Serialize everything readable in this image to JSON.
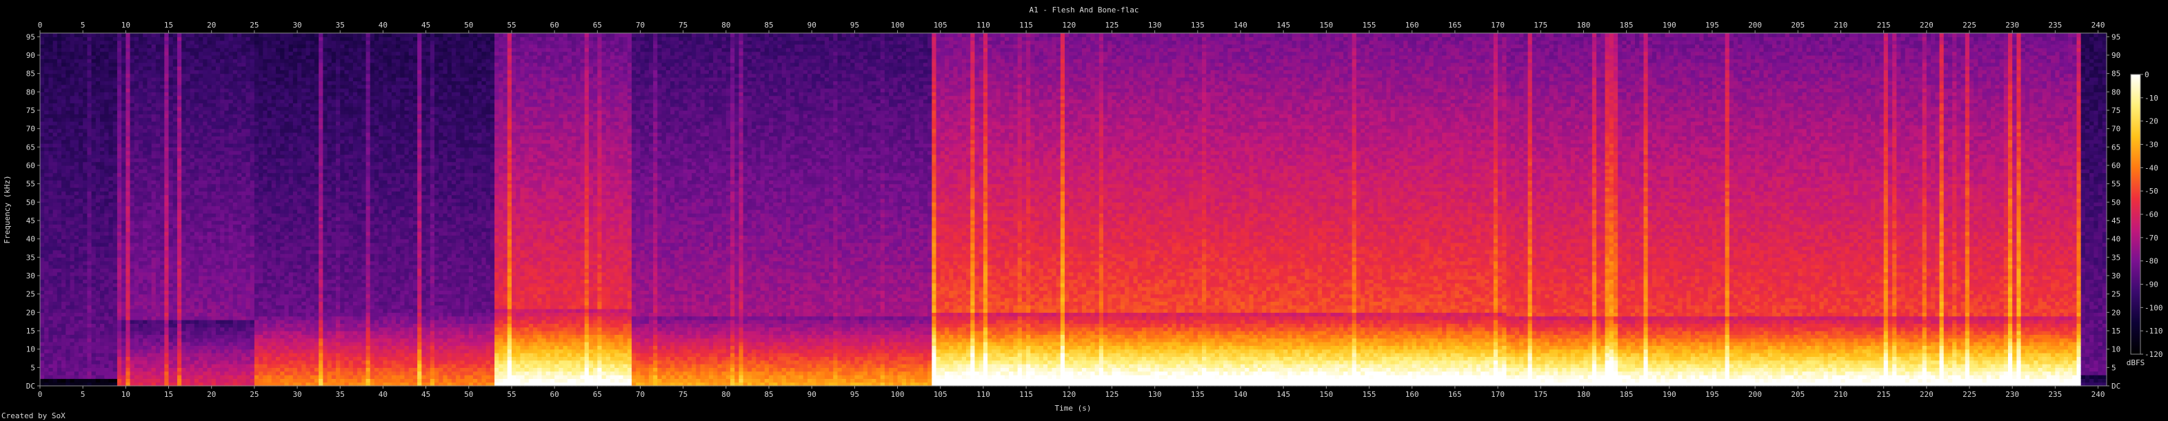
{
  "chart_data": {
    "type": "heatmap",
    "title": "A1 - Flesh And Bone-flac",
    "xlabel": "Time (s)",
    "ylabel": "Frequency (kHz)",
    "xlim": [
      0,
      241
    ],
    "ylim": [
      0,
      96
    ],
    "x_ticks": [
      0,
      5,
      10,
      15,
      20,
      25,
      30,
      35,
      40,
      45,
      50,
      55,
      60,
      65,
      70,
      75,
      80,
      85,
      90,
      95,
      100,
      105,
      110,
      115,
      120,
      125,
      130,
      135,
      140,
      145,
      150,
      155,
      160,
      165,
      170,
      175,
      180,
      185,
      190,
      195,
      200,
      205,
      210,
      215,
      220,
      225,
      230,
      235,
      240
    ],
    "y_ticks": [
      0,
      5,
      10,
      15,
      20,
      25,
      30,
      35,
      40,
      45,
      50,
      55,
      60,
      65,
      70,
      75,
      80,
      85,
      90,
      95
    ],
    "y_zero_label": "DC",
    "colorbar": {
      "label": "dBFS",
      "ticks": [
        0,
        -10,
        -20,
        -30,
        -40,
        -50,
        -60,
        -70,
        -80,
        -90,
        -100,
        -110,
        -120
      ],
      "colors": [
        "#000000",
        "#0d0235",
        "#3a0a6e",
        "#7a1190",
        "#c2187a",
        "#ee2f3c",
        "#ff7a12",
        "#ffc21a",
        "#fff07a",
        "#ffffff"
      ]
    },
    "segments": [
      {
        "start": 0,
        "end": 9,
        "intensity": 0.05,
        "band_khz": 2,
        "hf": 0.3
      },
      {
        "start": 9,
        "end": 25,
        "intensity": 0.45,
        "band_khz": 18,
        "hf": 0.35
      },
      {
        "start": 25,
        "end": 53,
        "intensity": 0.6,
        "band_khz": 20,
        "hf": 0.3
      },
      {
        "start": 53,
        "end": 69,
        "intensity": 0.9,
        "band_khz": 21,
        "hf": 0.55
      },
      {
        "start": 69,
        "end": 104,
        "intensity": 0.65,
        "band_khz": 19,
        "hf": 0.4
      },
      {
        "start": 104,
        "end": 171,
        "intensity": 0.95,
        "band_khz": 20,
        "hf": 0.6
      },
      {
        "start": 171,
        "end": 238,
        "intensity": 0.92,
        "band_khz": 19,
        "hf": 0.58
      },
      {
        "start": 238,
        "end": 241,
        "intensity": 0.2,
        "band_khz": 3,
        "hf": 0.3
      }
    ],
    "grid": false,
    "legend": "right"
  },
  "footer": "Created by SoX"
}
